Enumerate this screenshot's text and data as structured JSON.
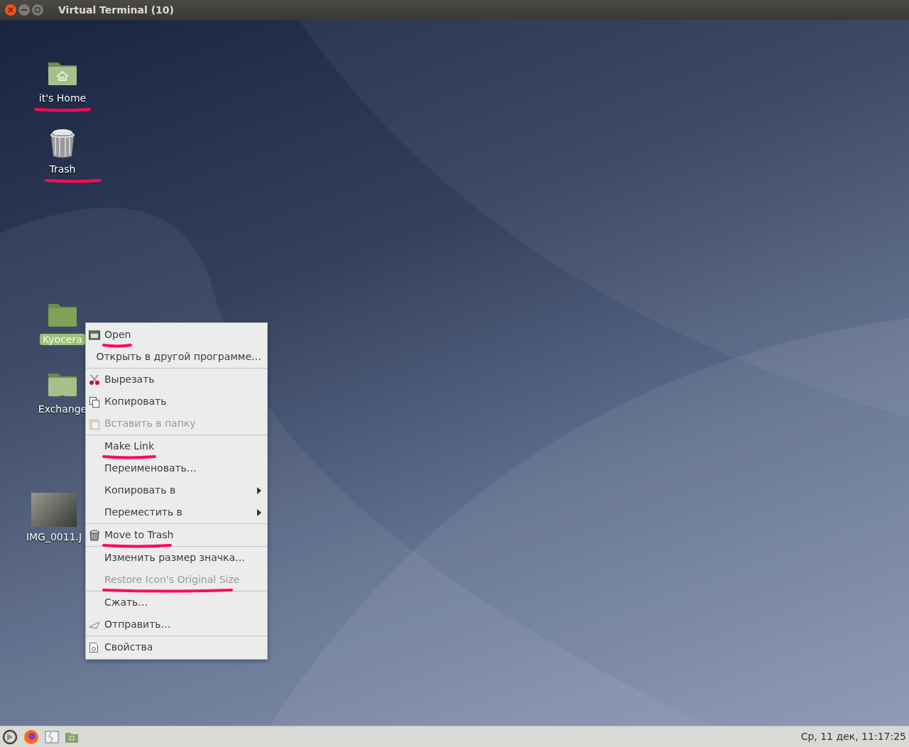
{
  "window": {
    "title": "Virtual Terminal (10)"
  },
  "desktop_icons": [
    {
      "label": "it's Home",
      "selected": false,
      "underlined": true
    },
    {
      "label": "Trash",
      "selected": false,
      "underlined": true
    },
    {
      "label": "Kyocera",
      "selected": true,
      "underlined": false
    },
    {
      "label": "Exchange",
      "selected": false,
      "underlined": false
    },
    {
      "label": "IMG_0011.J",
      "selected": false,
      "underlined": false
    }
  ],
  "context_menu": {
    "groups": [
      [
        {
          "label": "Open",
          "disabled": false,
          "submenu": false,
          "underlined": true
        },
        {
          "label": "Открыть в другой программе…",
          "disabled": false,
          "submenu": false,
          "underlined": false
        }
      ],
      [
        {
          "label": "Вырезать",
          "disabled": false,
          "submenu": false,
          "underlined": false
        },
        {
          "label": "Копировать",
          "disabled": false,
          "submenu": false,
          "underlined": false
        },
        {
          "label": "Вставить в папку",
          "disabled": true,
          "submenu": false,
          "underlined": false
        }
      ],
      [
        {
          "label": "Make Link",
          "disabled": false,
          "submenu": false,
          "underlined": true
        },
        {
          "label": "Переименовать…",
          "disabled": false,
          "submenu": false,
          "underlined": false
        },
        {
          "label": "Копировать в",
          "disabled": false,
          "submenu": true,
          "underlined": false
        },
        {
          "label": "Переместить в",
          "disabled": false,
          "submenu": true,
          "underlined": false
        }
      ],
      [
        {
          "label": "Move to Trash",
          "disabled": false,
          "submenu": false,
          "underlined": true
        }
      ],
      [
        {
          "label": "Изменить размер значка…",
          "disabled": false,
          "submenu": false,
          "underlined": false
        },
        {
          "label": "Restore Icon's Original Size",
          "disabled": true,
          "submenu": false,
          "underlined": true
        }
      ],
      [
        {
          "label": "Сжать…",
          "disabled": false,
          "submenu": false,
          "underlined": false
        },
        {
          "label": "Отправить…",
          "disabled": false,
          "submenu": false,
          "underlined": false
        }
      ],
      [
        {
          "label": "Свойства",
          "disabled": false,
          "submenu": false,
          "underlined": false
        }
      ]
    ]
  },
  "taskbar": {
    "clock": "Ср, 11 дек, 11:17:25"
  }
}
